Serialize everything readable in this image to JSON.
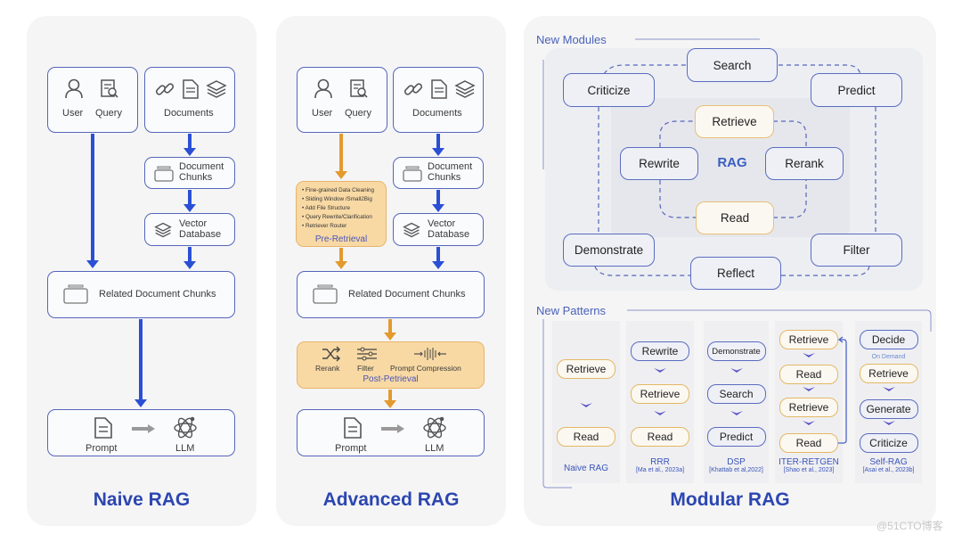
{
  "naive": {
    "title": "Naive RAG",
    "user": "User",
    "query": "Query",
    "documents": "Documents",
    "chunks_l1": "Document",
    "chunks_l2": "Chunks",
    "vector_l1": "Vector",
    "vector_l2": "Database",
    "related": "Related Document Chunks",
    "prompt": "Prompt",
    "llm": "LLM"
  },
  "advanced": {
    "title": "Advanced RAG",
    "user": "User",
    "query": "Query",
    "documents": "Documents",
    "chunks_l1": "Document",
    "chunks_l2": "Chunks",
    "vector_l1": "Vector",
    "vector_l2": "Database",
    "pre_items": [
      "Fine-grained Data Cleaning",
      "Sliding Window /Small2Big",
      "Add File Structure",
      "Query Rewrite/Clarification",
      "Retriever Router"
    ],
    "pre_title": "Pre-Retrieval",
    "related": "Related Document Chunks",
    "rerank": "Rerank",
    "filter": "Filter",
    "compression": "Prompt Compression",
    "post_title": "Post-Petrieval",
    "prompt": "Prompt",
    "llm": "LLM"
  },
  "modular": {
    "title": "Modular RAG",
    "modules_heading": "New Modules",
    "modules": {
      "search": "Search",
      "criticize": "Criticize",
      "predict": "Predict",
      "retrieve": "Retrieve",
      "rewrite": "Rewrite",
      "rag": "RAG",
      "rerank": "Rerank",
      "read": "Read",
      "demonstrate": "Demonstrate",
      "filter": "Filter",
      "reflect": "Reflect"
    },
    "patterns_heading": "New Patterns",
    "patterns": [
      {
        "name": "Naive RAG",
        "ref": "",
        "steps": [
          "Retrieve",
          "Read"
        ]
      },
      {
        "name": "RRR",
        "ref": "[Ma et al., 2023a]",
        "steps": [
          "Rewrite",
          "Retrieve",
          "Read"
        ]
      },
      {
        "name": "DSP",
        "ref": "[Khattab et al,2022]",
        "steps": [
          "Demonstrate",
          "Search",
          "Predict"
        ]
      },
      {
        "name": "ITER-RETGEN",
        "ref": "[Shao et al., 2023]",
        "steps": [
          "Retrieve",
          "Read",
          "Retrieve",
          "Read"
        ]
      },
      {
        "name": "Self-RAG",
        "ref": "[Asai et al., 2023b]",
        "steps": [
          "Decide",
          "Retrieve",
          "Generate",
          "Criticize"
        ],
        "note": "On Demand"
      }
    ]
  },
  "watermark": "@51CTO博客"
}
